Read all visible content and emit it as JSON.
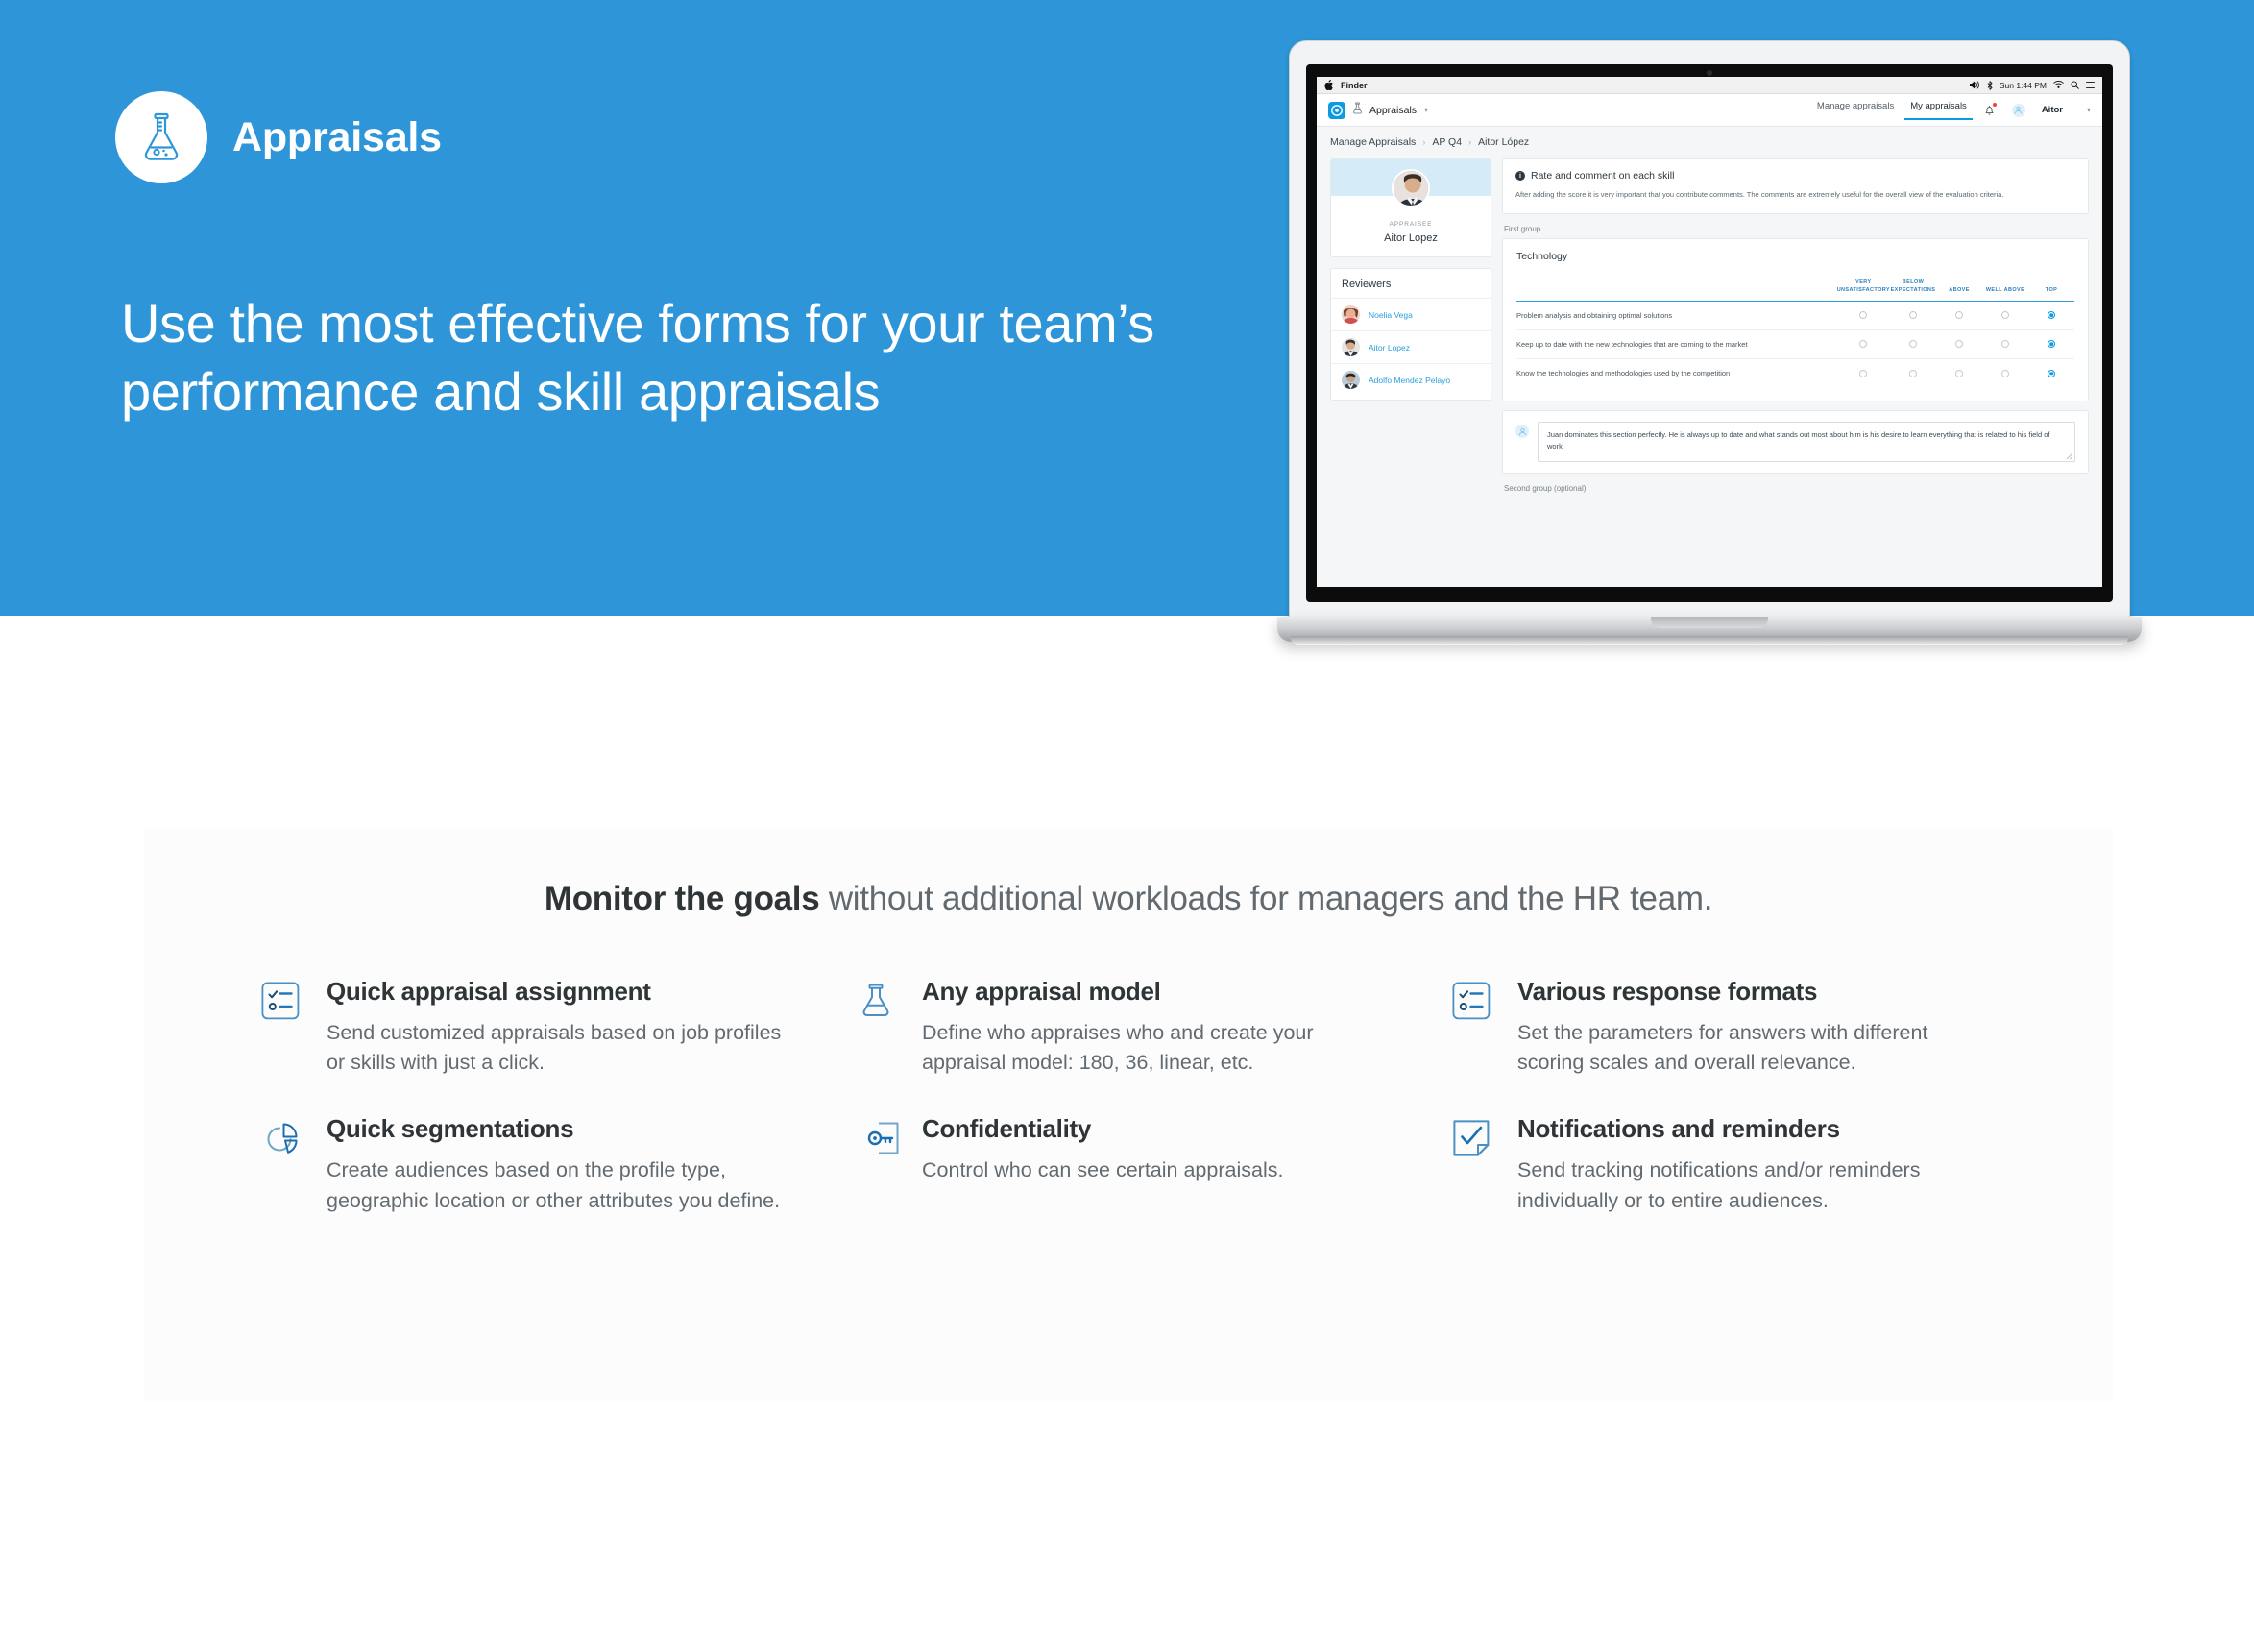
{
  "theme": {
    "brand_blue": "#2e96d8",
    "accent_blue": "#0c9ae0",
    "link_blue": "#2a9fdc",
    "icon_blue": "#3d8ec4"
  },
  "hero": {
    "logo_icon": "flask-icon",
    "brand_title": "Appraisals",
    "headline": "Use the most effective forms for your team’s performance and skill appraisals"
  },
  "laptop": {
    "macbar": {
      "apple_icon": "apple-icon",
      "app_name": "Finder",
      "volume_icon": "volume-icon",
      "bluetooth_icon": "bluetooth-icon",
      "clock": "Sun 1:44 PM",
      "wifi_icon": "wifi-icon",
      "search_icon": "search-icon",
      "controlcenter_icon": "control-center-icon"
    },
    "app": {
      "nav": {
        "logo_icon": "app-logo-icon",
        "module_icon": "flask-icon",
        "module_label": "Appraisals",
        "module_caret": "chevron-down-icon",
        "tabs": [
          {
            "label": "Manage appraisals",
            "active": false
          },
          {
            "label": "My appraisals",
            "active": true
          }
        ],
        "bell_icon": "bell-icon",
        "avatar_icon": "user-avatar-icon",
        "user_name": "Aitor",
        "user_caret": "chevron-down-icon"
      },
      "breadcrumb": [
        "Manage Appraisals",
        "AP Q4",
        "Aitor López"
      ],
      "appraisee": {
        "role_label": "APPRAISEE",
        "name": "Aitor Lopez"
      },
      "reviewers": {
        "title": "Reviewers",
        "items": [
          {
            "name": "Noelia Vega"
          },
          {
            "name": "Aitor Lopez"
          },
          {
            "name": "Adolfo Mendez Pelayo"
          }
        ]
      },
      "info_panel": {
        "icon": "info-icon",
        "title": "Rate and comment on each skill",
        "text": "After adding the score it is very important that you contribute comments. The comments are extremely useful for the overall view of the evaluation criteria."
      },
      "group_label": "First group",
      "group_label_2": "Second group (optional)",
      "skills": {
        "section_title": "Technology",
        "columns": [
          "VERY UNSATISFACTORY",
          "BELOW EXPECTATIONS",
          "ABOVE",
          "WELL ABOVE",
          "TOP"
        ],
        "rows": [
          {
            "question": "Problem analysis and obtaining optimal solutions",
            "selected": 4
          },
          {
            "question": "Keep up to date with the new technologies that are coming to the market",
            "selected": 4
          },
          {
            "question": "Know the technologies and methodologies used by the competition",
            "selected": 4
          }
        ]
      },
      "comment": {
        "avatar_icon": "user-avatar-icon",
        "value": "Juan dominates this section perfectly. He is always up to date and what stands out most about him is his desire to learn everything that is related to his field of work"
      }
    }
  },
  "features_section": {
    "heading_bold": "Monitor the goals",
    "heading_rest": " without additional workloads for managers and the HR team.",
    "items": [
      {
        "icon": "checklist-icon",
        "title": "Quick appraisal assignment",
        "desc": "Send customized appraisals based on job profiles or skills with just a click."
      },
      {
        "icon": "flask-icon",
        "title": "Any appraisal model",
        "desc": "Define who appraises who and create your appraisal model: 180, 36, linear, etc."
      },
      {
        "icon": "checklist-icon",
        "title": "Various response formats",
        "desc": "Set the parameters for answers with different scoring scales and overall relevance."
      },
      {
        "icon": "pie-chart-icon",
        "title": "Quick segmentations",
        "desc": "Create audiences based on the profile type, geographic location or other attributes you define."
      },
      {
        "icon": "key-document-icon",
        "title": "Confidentiality",
        "desc": "Control who can see certain appraisals."
      },
      {
        "icon": "check-note-icon",
        "title": "Notifications and reminders",
        "desc": "Send tracking notifications and/or reminders individually or to entire audiences."
      }
    ]
  }
}
